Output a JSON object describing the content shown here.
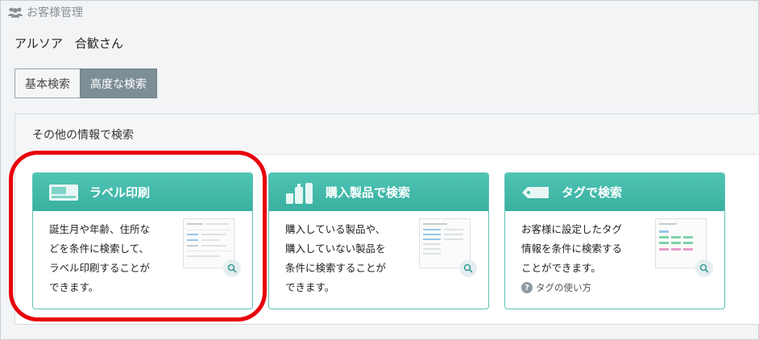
{
  "header": {
    "title": "お客様管理",
    "icon": "users-icon"
  },
  "customer": {
    "name": "アルソア　合歓さん"
  },
  "tabs": [
    {
      "label": "基本検索",
      "active": false
    },
    {
      "label": "高度な検索",
      "active": true
    }
  ],
  "panel": {
    "title": "その他の情報で検索",
    "cards": [
      {
        "title": "ラベル印刷",
        "icon": "label-icon",
        "lines": [
          "誕生月や年齢、住所な",
          "どを条件に検索して、",
          "ラベル印刷することが",
          "できます。"
        ]
      },
      {
        "title": "購入製品で検索",
        "icon": "products-icon",
        "lines": [
          "購入している製品や、",
          "購入していない製品を",
          "条件に検索することが",
          "できます。"
        ]
      },
      {
        "title": "タグで検索",
        "icon": "tag-icon",
        "lines": [
          "お客様に設定したタグ",
          "情報を条件に検索する",
          "ことができます。"
        ],
        "help_link": "タグの使い方"
      }
    ]
  },
  "colors": {
    "accent": "#42b8a9",
    "highlight": "#e8000b"
  }
}
